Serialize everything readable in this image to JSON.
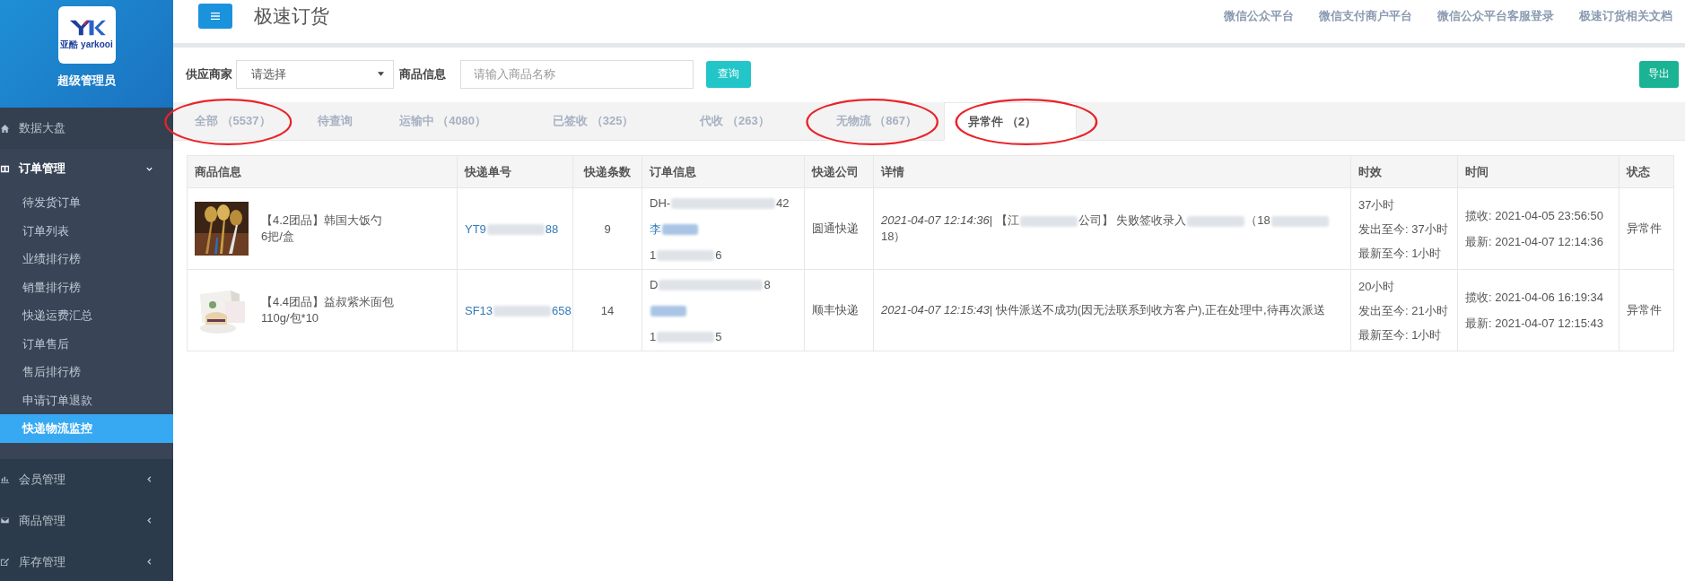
{
  "sidebar": {
    "logo_text": "亚酷 yarkooi",
    "user": "超级管理员",
    "items": [
      {
        "label": "数据大盘"
      },
      {
        "label": "订单管理",
        "expanded": true,
        "children": [
          {
            "label": "待发货订单",
            "selected": false
          },
          {
            "label": "订单列表",
            "selected": false
          },
          {
            "label": "业绩排行榜",
            "selected": false
          },
          {
            "label": "销量排行榜",
            "selected": false
          },
          {
            "label": "快递运费汇总",
            "selected": false
          },
          {
            "label": "订单售后",
            "selected": false
          },
          {
            "label": "售后排行榜",
            "selected": false
          },
          {
            "label": "申请订单退款",
            "selected": false
          },
          {
            "label": "快递物流监控",
            "selected": true
          }
        ]
      },
      {
        "label": "会员管理",
        "expanded": false
      },
      {
        "label": "商品管理",
        "expanded": false
      },
      {
        "label": "库存管理",
        "expanded": false
      }
    ]
  },
  "header": {
    "title": "极速订货",
    "links": [
      "微信公众平台",
      "微信支付商户平台",
      "微信公众平台客服登录",
      "极速订货相关文档"
    ]
  },
  "filters": {
    "supplier_label": "供应商家",
    "supplier_value": "请选择",
    "product_label": "商品信息",
    "product_placeholder": "请输入商品名称",
    "query_button": "查询",
    "export_button": "导出"
  },
  "tabs": [
    {
      "label": "全部 （5537）",
      "selected": false,
      "circled": true
    },
    {
      "label": "待查询",
      "selected": false,
      "circled": false
    },
    {
      "label": "运输中 （4080）",
      "selected": false,
      "circled": false
    },
    {
      "label": "已签收 （325）",
      "selected": false,
      "circled": false
    },
    {
      "label": "代收 （263）",
      "selected": false,
      "circled": false
    },
    {
      "label": "无物流 （867）",
      "selected": false,
      "circled": true
    },
    {
      "label": "异常件 （2）",
      "selected": true,
      "circled": true
    }
  ],
  "table": {
    "columns": [
      "商品信息",
      "快递单号",
      "快递条数",
      "订单信息",
      "快递公司",
      "详情",
      "时效",
      "时间",
      "状态"
    ],
    "rows": [
      {
        "product": "【4.2团品】韩国大饭勺",
        "spec": "6把/盒",
        "tracking_prefix": "YT9",
        "tracking_suffix": "88",
        "count": "9",
        "order_lines": [
          {
            "prefix": "DH-",
            "suffix": "42",
            "link": false
          },
          {
            "prefix": "李",
            "link": true
          },
          {
            "prefix": "1",
            "suffix": "6",
            "link": false
          }
        ],
        "company": "圆通快递",
        "detail_time": "2021-04-07 12:14:36",
        "detail_parts": [
          "| 【江",
          "公司】 失败签收录入",
          "（18",
          "18）"
        ],
        "aging": [
          "37小时",
          "发出至今: 37小时",
          "最新至今: 1小时"
        ],
        "times": [
          "揽收: 2021-04-05 23:56:50",
          "最新: 2021-04-07 12:14:36"
        ],
        "status": "异常件"
      },
      {
        "product": "【4.4团品】益叔紫米面包",
        "spec": "110g/包*10",
        "tracking_prefix": "SF13",
        "tracking_suffix": "658",
        "count": "14",
        "order_lines": [
          {
            "prefix": "D",
            "suffix": "8",
            "link": false
          },
          {
            "link": true
          },
          {
            "prefix": "1",
            "suffix": "5",
            "link": false
          }
        ],
        "company": "顺丰快递",
        "detail_time": "2021-04-07 12:15:43",
        "detail_parts": [
          "| 快件派送不成功(因无法联系到收方客户),正在处理中,待再次派送"
        ],
        "aging": [
          "20小时",
          "发出至今: 21小时",
          "最新至今: 1小时"
        ],
        "times": [
          "揽收: 2021-04-06 16:19:34",
          "最新: 2021-04-07 12:15:43"
        ],
        "status": "异常件"
      }
    ]
  }
}
